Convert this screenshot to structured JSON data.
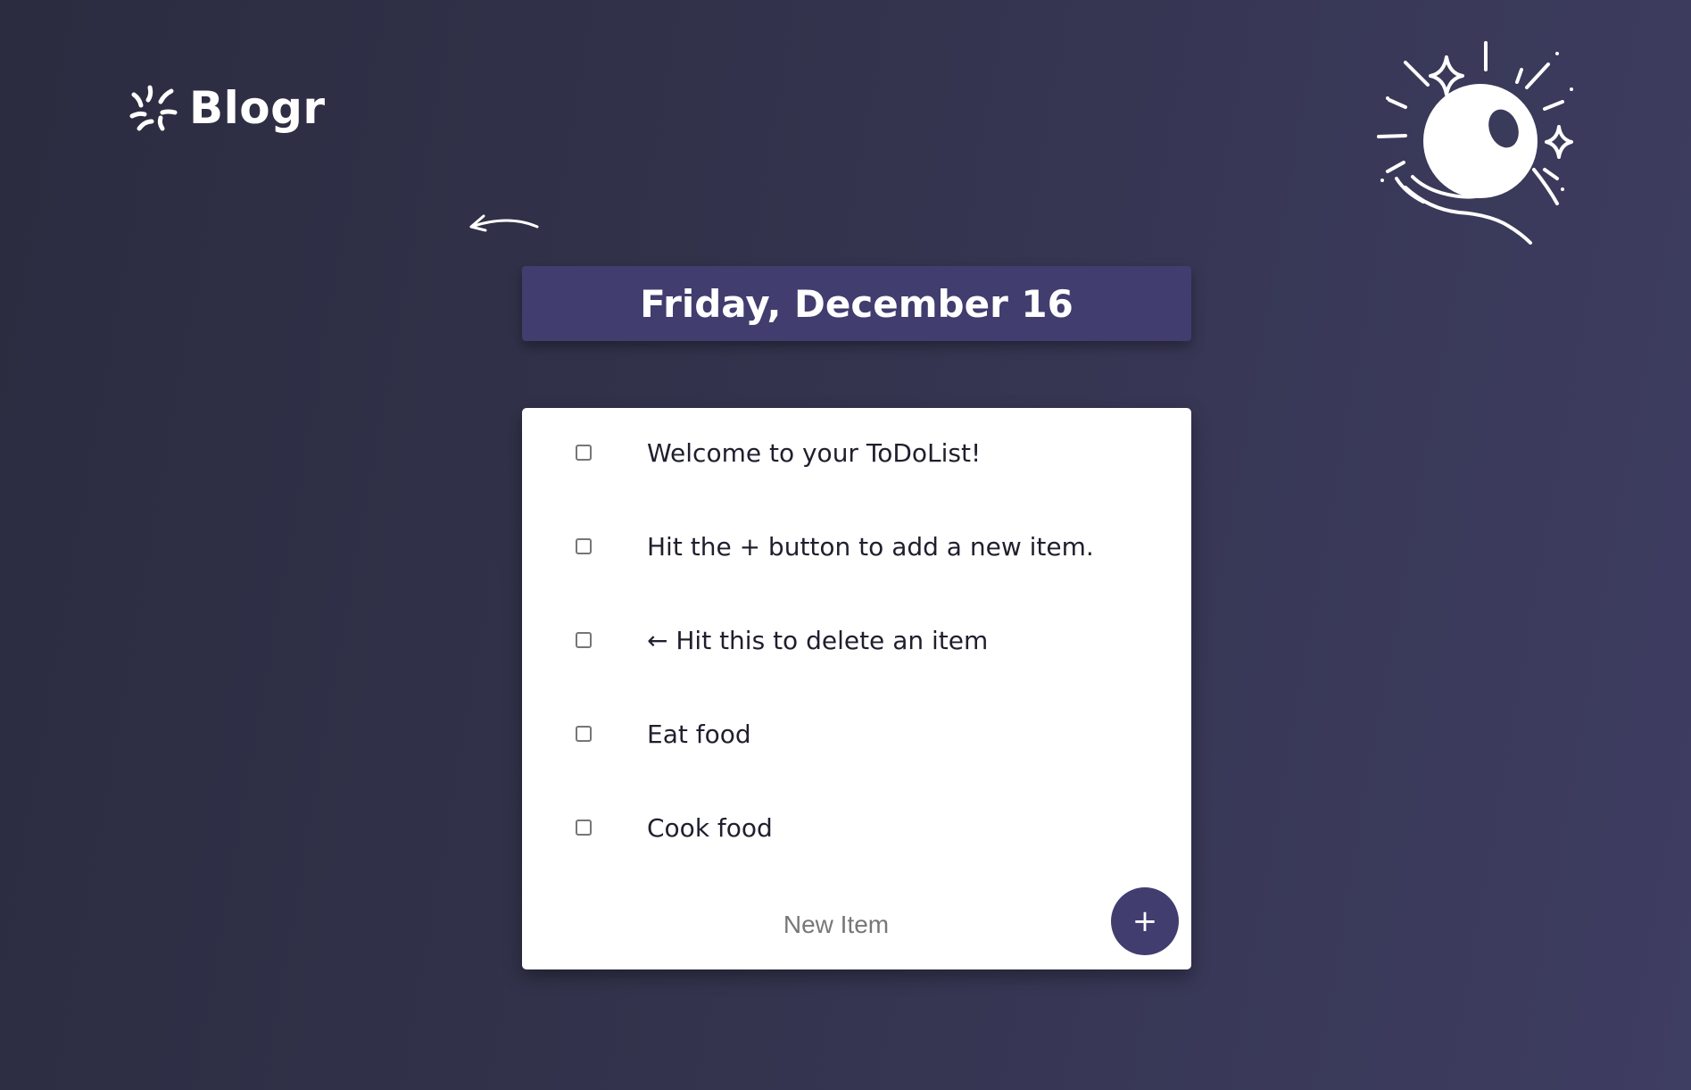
{
  "brand": {
    "logo_text": "Blogr",
    "logo_icon": "sparkle-burst-icon"
  },
  "navigation": {
    "back_icon": "curved-back-arrow-icon"
  },
  "illustration": {
    "icon": "crystal-ball-hand-icon"
  },
  "header": {
    "date": "Friday, December 16"
  },
  "todo": {
    "items": [
      {
        "label": "Welcome to your ToDoList!",
        "checked": false
      },
      {
        "label": "Hit the + button to add a new item.",
        "checked": false
      },
      {
        "label": "← Hit this to delete an item",
        "checked": false
      },
      {
        "label": "Eat food",
        "checked": false
      },
      {
        "label": "Cook food",
        "checked": false
      }
    ],
    "new_item_placeholder": "New Item",
    "add_button_label": "+"
  },
  "colors": {
    "accent": "#413d6f",
    "background_start": "#2b2c40",
    "background_end": "#3e3d62",
    "card": "#ffffff",
    "text": "#1f1f2e"
  }
}
